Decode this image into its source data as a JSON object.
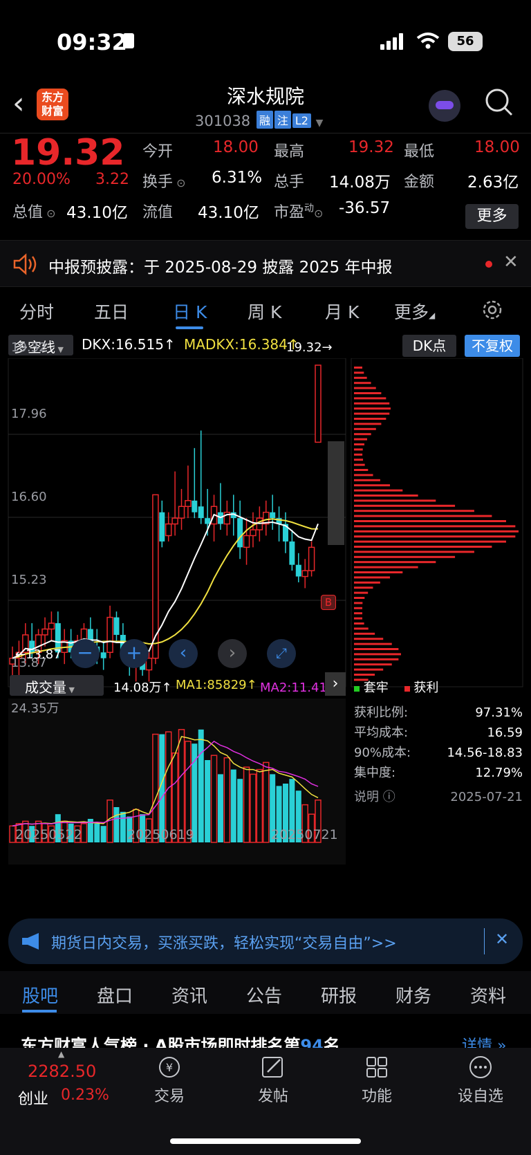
{
  "status": {
    "time": "09:32",
    "battery": "56"
  },
  "header": {
    "logo": "东方财富",
    "name": "深水规院",
    "code": "301038",
    "tags": [
      "融",
      "注",
      "L2"
    ]
  },
  "quote": {
    "price": "19.32",
    "change_pct": "20.00%",
    "change": "3.22",
    "fields": [
      {
        "label": "今开",
        "value": "18.00"
      },
      {
        "label": "最高",
        "value": "19.32"
      },
      {
        "label": "最低",
        "value": "18.00"
      },
      {
        "label": "换手",
        "value": "6.31%"
      },
      {
        "label": "总手",
        "value": "14.08万"
      },
      {
        "label": "金额",
        "value": "2.63亿"
      },
      {
        "label": "总值",
        "value": "43.10亿"
      },
      {
        "label": "流值",
        "value": "43.10亿"
      },
      {
        "label": "市盈",
        "sup": "动",
        "value": "-36.57"
      }
    ],
    "more": "更多"
  },
  "notice": {
    "text": "中报预披露：于 2025-08-29 披露 2025 年中报"
  },
  "tabs": [
    "分时",
    "五日",
    "日 K",
    "周 K",
    "月 K",
    "更多"
  ],
  "active_tab": "日 K",
  "indicator": {
    "name": "多空线",
    "dkx": "DKX:16.515↑",
    "madkx": "MADKX:16.384↑",
    "dk": "DK点",
    "fq": "不复权"
  },
  "price_axis": [
    "19.32",
    "17.96",
    "16.60",
    "15.23",
    "13.87"
  ],
  "price_marks": {
    "high": "19.32→",
    "low": "←13.87",
    "buy": "B"
  },
  "volume": {
    "name": "成交量",
    "value": "14.08万↑",
    "ma1": "MA1:85829↑",
    "ma2": "MA2:11.41万",
    "max": "24.35万"
  },
  "dates": [
    "20250522",
    "20250619",
    "20250721"
  ],
  "chip": {
    "legend": [
      "套牢",
      "获利"
    ],
    "rows": [
      {
        "label": "获利比例:",
        "value": "97.31%"
      },
      {
        "label": "平均成本:",
        "value": "16.59"
      },
      {
        "label": "90%成本:",
        "value": "14.56-18.83"
      },
      {
        "label": "集中度:",
        "value": "12.79%"
      },
      {
        "label": "说明",
        "value": "2025-07-21"
      }
    ]
  },
  "ad": {
    "text": "期货日内交易，买涨买跌，轻松实现“交易自由”>>"
  },
  "bottom_tabs": [
    "股吧",
    "盘口",
    "资讯",
    "公告",
    "研报",
    "财务",
    "资料"
  ],
  "rank": {
    "text": "东方财富人气榜 · A股市场即时排名第",
    "rank": "94",
    "unit": "名",
    "detail": "详情 »"
  },
  "index": {
    "value": "2282.50",
    "name": "创业",
    "pct": "0.23%"
  },
  "nav": [
    "交易",
    "发帖",
    "功能",
    "设自选"
  ],
  "colors": {
    "up": "#e8272a",
    "down": "#2ad0d6",
    "accent": "#3d8ce8",
    "madkx": "#f0e040",
    "ma2": "#e030e0"
  },
  "chart_data": {
    "type": "candlestick",
    "price_range": [
      13.87,
      19.32
    ],
    "candles": [
      [
        14.2,
        14.5,
        13.9,
        14.3
      ],
      [
        14.3,
        14.6,
        14.0,
        14.4
      ],
      [
        14.4,
        14.9,
        14.2,
        14.7
      ],
      [
        14.6,
        14.9,
        14.3,
        14.4
      ],
      [
        14.4,
        14.8,
        14.2,
        14.7
      ],
      [
        14.7,
        15.0,
        14.5,
        14.8
      ],
      [
        14.8,
        15.1,
        14.6,
        14.9
      ],
      [
        14.9,
        15.1,
        14.3,
        14.4
      ],
      [
        14.4,
        14.8,
        14.2,
        14.6
      ],
      [
        14.6,
        14.8,
        14.3,
        14.4
      ],
      [
        14.4,
        14.7,
        14.2,
        14.6
      ],
      [
        14.6,
        14.9,
        14.4,
        14.8
      ],
      [
        14.8,
        15.0,
        14.4,
        14.5
      ],
      [
        14.5,
        14.8,
        14.2,
        14.4
      ],
      [
        14.4,
        14.6,
        14.1,
        14.3
      ],
      [
        14.4,
        15.2,
        14.3,
        15.0
      ],
      [
        15.0,
        15.1,
        14.6,
        14.7
      ],
      [
        14.7,
        14.9,
        14.3,
        14.4
      ],
      [
        14.4,
        14.6,
        14.0,
        14.2
      ],
      [
        14.2,
        14.5,
        13.9,
        14.3
      ],
      [
        14.3,
        14.5,
        14.0,
        14.1
      ],
      [
        14.1,
        14.4,
        13.9,
        14.3
      ],
      [
        14.3,
        17.1,
        14.2,
        17.1
      ],
      [
        16.8,
        17.0,
        16.2,
        16.3
      ],
      [
        16.4,
        16.8,
        16.3,
        16.6
      ],
      [
        16.6,
        17.5,
        16.4,
        16.7
      ],
      [
        16.7,
        17.2,
        16.5,
        16.9
      ],
      [
        16.9,
        17.6,
        16.7,
        17.0
      ],
      [
        17.0,
        17.9,
        16.7,
        16.8
      ],
      [
        16.9,
        18.2,
        16.6,
        16.7
      ],
      [
        16.7,
        17.2,
        16.4,
        16.6
      ],
      [
        16.6,
        17.1,
        16.3,
        16.9
      ],
      [
        16.8,
        17.3,
        16.5,
        16.6
      ],
      [
        16.6,
        17.0,
        16.4,
        16.8
      ],
      [
        16.8,
        17.1,
        16.4,
        16.7
      ],
      [
        16.7,
        17.0,
        16.0,
        16.2
      ],
      [
        16.2,
        16.7,
        15.9,
        16.4
      ],
      [
        16.4,
        16.8,
        16.2,
        16.5
      ],
      [
        16.5,
        16.9,
        16.3,
        16.7
      ],
      [
        16.6,
        17.0,
        16.4,
        16.8
      ],
      [
        16.8,
        17.1,
        16.5,
        16.7
      ],
      [
        16.7,
        16.9,
        16.3,
        16.6
      ],
      [
        16.6,
        16.8,
        16.1,
        16.3
      ],
      [
        16.3,
        16.5,
        15.8,
        15.9
      ],
      [
        15.9,
        16.1,
        15.6,
        15.7
      ],
      [
        15.7,
        16.0,
        15.5,
        15.8
      ],
      [
        15.8,
        16.3,
        15.7,
        16.2
      ],
      [
        18.0,
        19.32,
        18.0,
        19.32
      ]
    ],
    "dkx_line": "white",
    "madkx_line": "yellow",
    "volumes": [
      0.7,
      0.8,
      0.9,
      0.7,
      0.9,
      0.8,
      0.7,
      1.2,
      0.9,
      0.8,
      0.7,
      0.8,
      1.0,
      0.8,
      0.7,
      1.8,
      1.5,
      1.3,
      1.1,
      1.4,
      1.2,
      1.0,
      4.6,
      4.6,
      4.7,
      3.8,
      4.8,
      4.3,
      4.2,
      4.8,
      3.5,
      3.7,
      2.9,
      3.6,
      3.1,
      2.7,
      3.2,
      2.9,
      3.1,
      3.4,
      2.9,
      2.4,
      2.5,
      2.7,
      2.2,
      1.6,
      1.2,
      1.8,
      2.9
    ]
  }
}
